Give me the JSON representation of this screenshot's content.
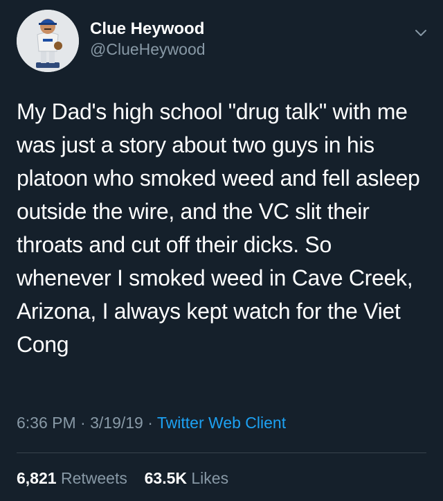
{
  "user": {
    "display_name": "Clue Heywood",
    "handle": "@ClueHeywood"
  },
  "tweet": {
    "text": "My Dad's high school \"drug talk\" with me was just a story about two guys in his platoon who smoked weed and fell asleep outside the wire, and the VC slit their throats and cut off their dicks. So whenever I smoked weed in Cave Creek, Arizona, I always kept watch for the Viet Cong",
    "time": "6:36 PM",
    "date": "3/19/19",
    "separator": "·",
    "client": "Twitter Web Client"
  },
  "stats": {
    "retweets_count": "6,821",
    "retweets_label": "Retweets",
    "likes_count": "63.5K",
    "likes_label": "Likes"
  },
  "icons": {
    "menu": "chevron-down-icon",
    "avatar": "bobblehead-avatar"
  },
  "colors": {
    "background": "#15202b",
    "primary_text": "#ffffff",
    "secondary_text": "#8899a6",
    "link": "#1da1f2",
    "divider": "#38444d"
  }
}
